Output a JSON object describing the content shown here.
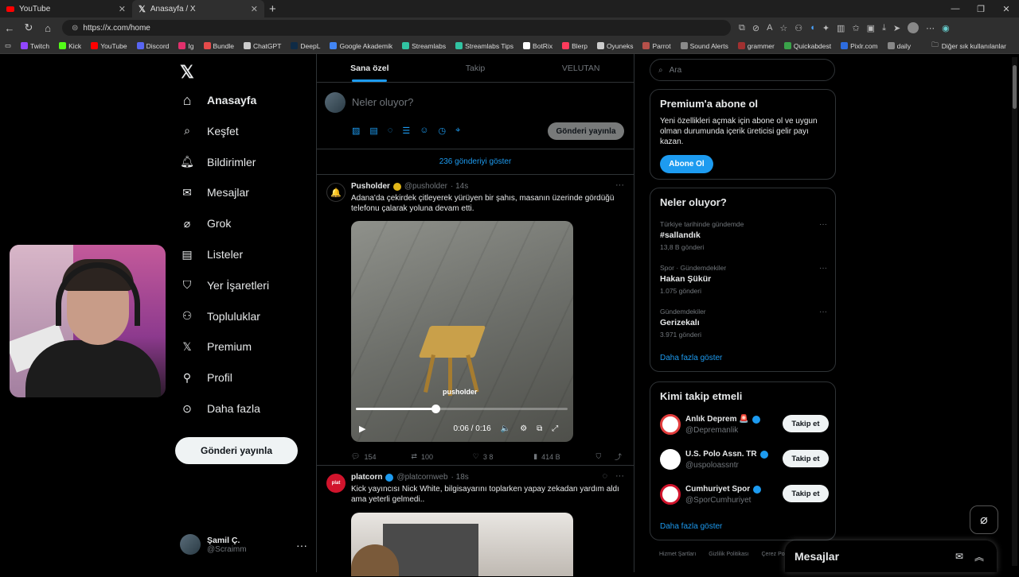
{
  "browser": {
    "tabs": [
      {
        "title": "YouTube",
        "icon": "youtube-icon"
      },
      {
        "title": "Anasayfa / X",
        "icon": "x-icon"
      }
    ],
    "url": "https://x.com/home"
  },
  "bookmarks": [
    {
      "label": "Twitch",
      "color": "#9146ff"
    },
    {
      "label": "Kick",
      "color": "#53fc18"
    },
    {
      "label": "YouTube",
      "color": "#ff0000"
    },
    {
      "label": "Discord",
      "color": "#5865f2"
    },
    {
      "label": "Ig",
      "color": "#e1306c"
    },
    {
      "label": "Bundle",
      "color": "#e64a4a"
    },
    {
      "label": "ChatGPT",
      "color": "#cccccc"
    },
    {
      "label": "DeepL",
      "color": "#0f2b46"
    },
    {
      "label": "Google Akademik",
      "color": "#4285f4"
    },
    {
      "label": "Streamlabs",
      "color": "#31c3a2"
    },
    {
      "label": "Streamlabs Tips",
      "color": "#31c3a2"
    },
    {
      "label": "BotRix",
      "color": "#ffffff"
    },
    {
      "label": "Blerp",
      "color": "#ff3b5c"
    },
    {
      "label": "Oyuneks",
      "color": "#cccccc"
    },
    {
      "label": "Parrot",
      "color": "#b5504a"
    },
    {
      "label": "Sound Alerts",
      "color": "#8a8a8a"
    },
    {
      "label": "grammer",
      "color": "#a03030"
    },
    {
      "label": "Quickabdest",
      "color": "#3aa34a"
    },
    {
      "label": "Pixlr.com",
      "color": "#2d6cdf"
    },
    {
      "label": "daily",
      "color": "#888888"
    }
  ],
  "bookmarks_other": "Diğer sık kullanılanlar",
  "nav": {
    "items": [
      {
        "label": "Anasayfa",
        "icon": "home-icon"
      },
      {
        "label": "Keşfet",
        "icon": "search-icon"
      },
      {
        "label": "Bildirimler",
        "icon": "bell-icon"
      },
      {
        "label": "Mesajlar",
        "icon": "mail-icon"
      },
      {
        "label": "Grok",
        "icon": "grok-icon"
      },
      {
        "label": "Listeler",
        "icon": "list-icon"
      },
      {
        "label": "Yer İşaretleri",
        "icon": "bookmark-icon"
      },
      {
        "label": "Topluluklar",
        "icon": "communities-icon"
      },
      {
        "label": "Premium",
        "icon": "x-icon"
      },
      {
        "label": "Profil",
        "icon": "person-icon"
      },
      {
        "label": "Daha fazla",
        "icon": "more-circle-icon"
      }
    ],
    "post_button": "Gönderi yayınla",
    "account": {
      "name": "Şamil Ç.",
      "handle": "@Scraimm"
    }
  },
  "timeline": {
    "tabs": [
      "Sana özel",
      "Takip",
      "VELUTAN"
    ],
    "compose_placeholder": "Neler oluyor?",
    "compose_post": "Gönderi yayınla",
    "show_new": "236 gönderiyi göster",
    "tweets": [
      {
        "name": "Pusholder",
        "handle": "@pusholder",
        "time": "· 14s",
        "text": "Adana'da çekirdek çitleyerek yürüyen bir şahıs, masanın üzerinde gördüğü telefonu çalarak yoluna devam etti.",
        "video_time": "0:06 / 0:16",
        "video_progress": 0.375,
        "watermark": "pusholder",
        "replies": "154",
        "reposts": "100",
        "likes": "3 8",
        "views": "414 B"
      },
      {
        "name": "platcorn",
        "handle": "@platcornweb",
        "time": "· 18s",
        "text": "Kick yayıncısı Nick White, bilgisayarını toplarken yapay zekadan yardım aldı ama yeterli gelmedi.."
      }
    ]
  },
  "sidebar": {
    "search_placeholder": "Ara",
    "premium": {
      "title": "Premium'a abone ol",
      "text": "Yeni özellikleri açmak için abone ol ve uygun olman durumunda içerik üreticisi gelir payı kazan.",
      "button": "Abone Ol"
    },
    "trends": {
      "title": "Neler oluyor?",
      "items": [
        {
          "category": "Türkiye tarihinde gündemde",
          "topic": "#sallandık",
          "count": "13,8 B gönderi"
        },
        {
          "category": "Spor · Gündemdekiler",
          "topic": "Hakan Şükür",
          "count": "1.075 gönderi"
        },
        {
          "category": "Gündemdekiler",
          "topic": "Gerizekalı",
          "count": "3.971 gönderi"
        }
      ],
      "more": "Daha fazla göster"
    },
    "who_to_follow": {
      "title": "Kimi takip etmeli",
      "items": [
        {
          "name": "Anlık Deprem 🚨",
          "handle": "@Depremanlik",
          "button": "Takip et"
        },
        {
          "name": "U.S. Polo Assn. TR",
          "handle": "@uspoloassntr",
          "button": "Takip et"
        },
        {
          "name": "Cumhuriyet Spor",
          "handle": "@SporCumhuriyet",
          "button": "Takip et"
        }
      ],
      "more": "Daha fazla göster"
    },
    "footer": [
      "Hizmet Şartları",
      "Gizlilik Politikası",
      "Çerez Pol"
    ]
  },
  "messages_bar": {
    "title": "Mesajlar"
  },
  "colors": {
    "accent": "#1d9bf0",
    "background": "#000000",
    "border": "#2f3336"
  }
}
